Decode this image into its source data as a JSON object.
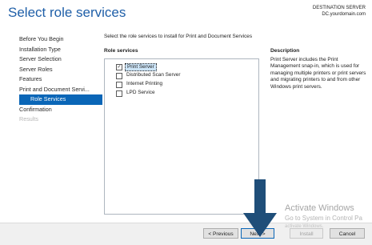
{
  "header": {
    "title": "Select role services",
    "destination_label": "DESTINATION SERVER",
    "destination_server": "DC.yourdomain.com"
  },
  "sidebar": {
    "items": [
      {
        "label": "Before You Begin",
        "state": "normal"
      },
      {
        "label": "Installation Type",
        "state": "normal"
      },
      {
        "label": "Server Selection",
        "state": "normal"
      },
      {
        "label": "Server Roles",
        "state": "normal"
      },
      {
        "label": "Features",
        "state": "normal"
      },
      {
        "label": "Print and Document Servi...",
        "state": "normal"
      },
      {
        "label": "Role Services",
        "state": "selected"
      },
      {
        "label": "Confirmation",
        "state": "normal"
      },
      {
        "label": "Results",
        "state": "disabled"
      }
    ]
  },
  "main": {
    "instruction": "Select the role services to install for Print and Document Services",
    "role_services_heading": "Role services",
    "description_heading": "Description",
    "role_services": [
      {
        "label": "Print Server",
        "checked": true,
        "selected": true
      },
      {
        "label": "Distributed Scan Server",
        "checked": false
      },
      {
        "label": "Internet Printing",
        "checked": false
      },
      {
        "label": "LPD Service",
        "checked": false
      }
    ],
    "description": "Print Server includes the Print Management snap-in, which is used for managing multiple printers or print servers and migrating printers to and from other Windows print servers."
  },
  "footer": {
    "previous_label": "< Previous",
    "next_label": "Next >",
    "install_label": "Install",
    "cancel_label": "Cancel"
  },
  "watermark": {
    "line1": "Activate Windows",
    "line2": "Go to System in Control Pa",
    "line3": "activate Windows."
  },
  "colors": {
    "accent": "#0a66b7",
    "title": "#1f5fa8",
    "arrow": "#1f4e79",
    "selection": "#cce4f7"
  }
}
